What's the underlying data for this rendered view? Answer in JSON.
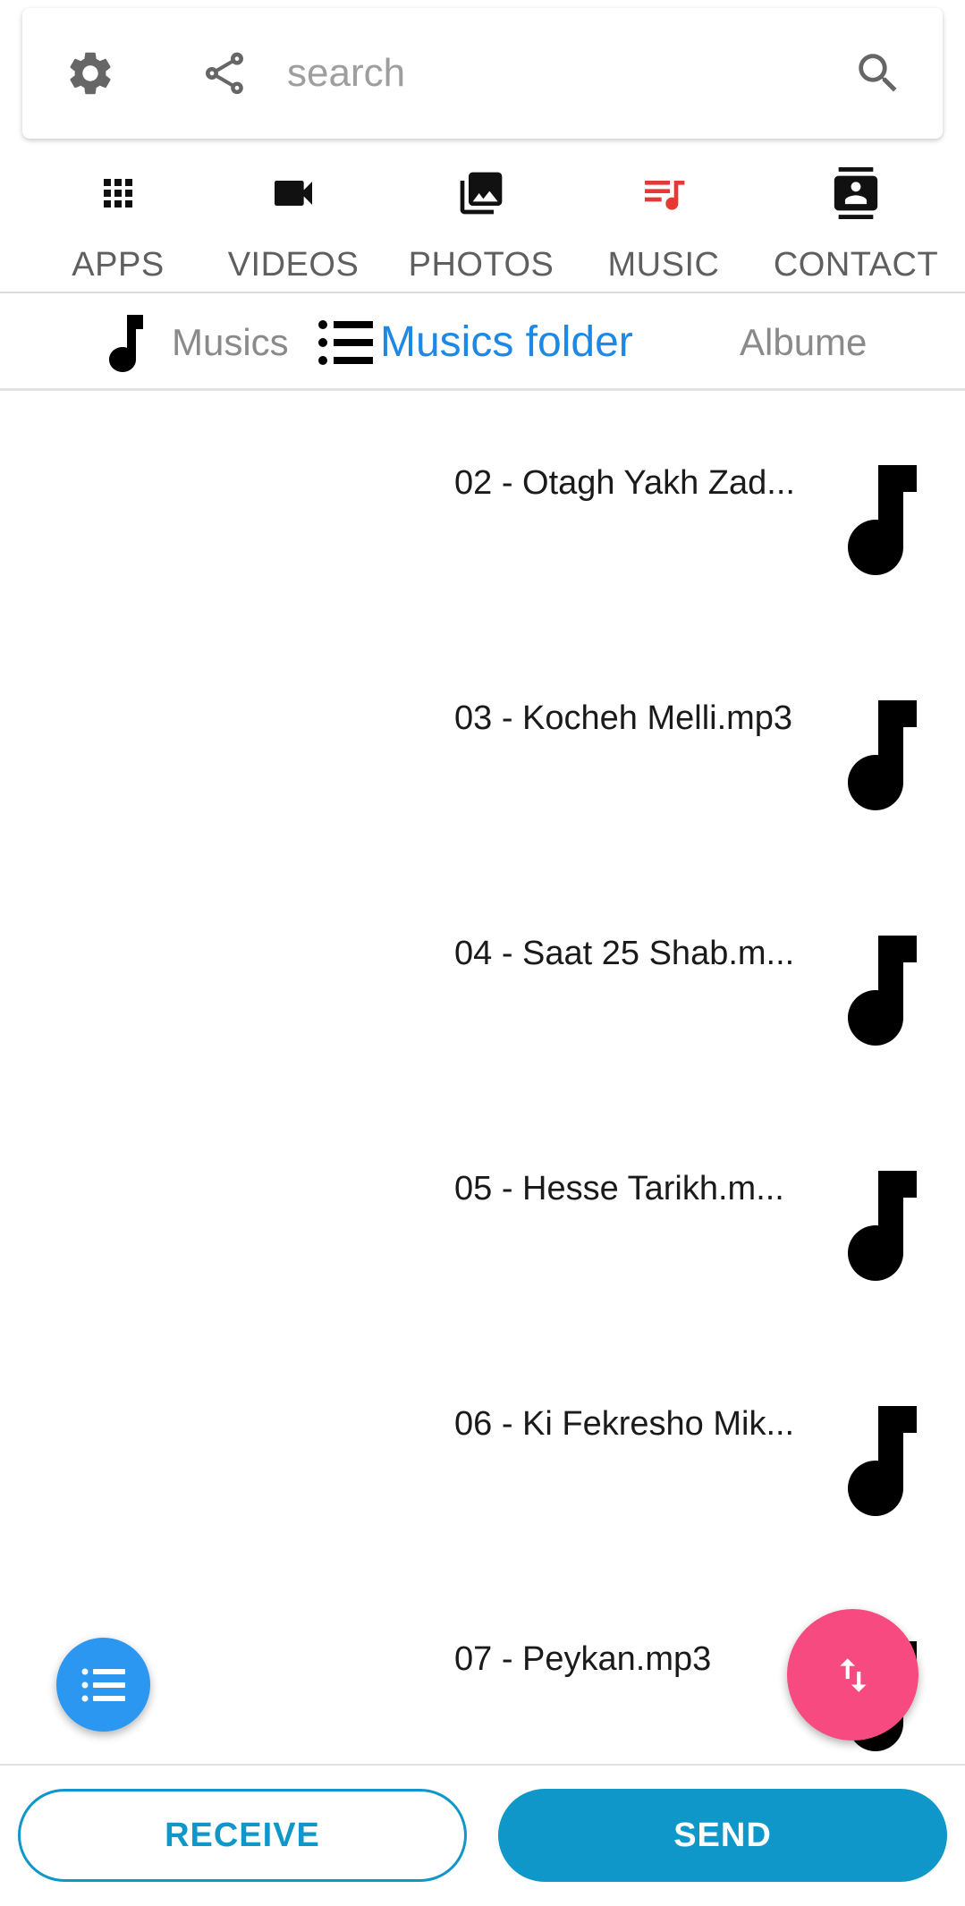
{
  "search": {
    "placeholder": "search"
  },
  "category_tabs": [
    {
      "label": "APPS",
      "icon": "apps-grid-icon"
    },
    {
      "label": "VIDEOS",
      "icon": "videocam-icon"
    },
    {
      "label": "PHOTOS",
      "icon": "photo-library-icon"
    },
    {
      "label": "MUSIC",
      "icon": "music-queue-icon",
      "active": true
    },
    {
      "label": "CONTACT",
      "icon": "contact-card-icon"
    }
  ],
  "sub_tabs": [
    {
      "label": "Musics",
      "icon": "music-note-icon"
    },
    {
      "label": "Musics folder",
      "icon": "list-icon",
      "active": true
    },
    {
      "label": "Albume"
    }
  ],
  "list_items": [
    {
      "title": "02 - Otagh Yakh Zad..."
    },
    {
      "title": "03 - Kocheh Melli.mp3"
    },
    {
      "title": "04 - Saat 25 Shab.m..."
    },
    {
      "title": "05 - Hesse Tarikh.m..."
    },
    {
      "title": "06 - Ki Fekresho Mik..."
    },
    {
      "title": "07 - Peykan.mp3"
    }
  ],
  "buttons": {
    "receive": "RECEIVE",
    "send": "SEND"
  },
  "colors": {
    "accent_blue": "#1e88e5",
    "music_active_red": "#e53935",
    "send_button": "#0f97c9",
    "fab_pink": "#f64a80",
    "fab_blue": "#2b97f0"
  }
}
